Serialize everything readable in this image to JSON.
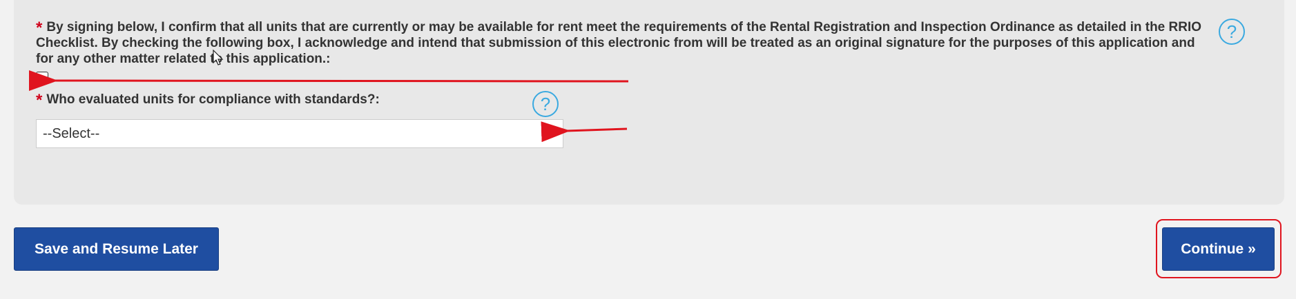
{
  "form": {
    "signature_statement": "By signing below, I confirm that all units that are currently or may be available for rent meet the requirements of the Rental Registration and Inspection Ordinance as detailed in the RRIO Checklist. By checking the following box, I acknowledge and intend that submission of this electronic from will be treated as an original signature for the purposes of this application and for any other matter related to this application.:",
    "signature_required_marker": "*",
    "signature_checkbox_checked": false,
    "evaluator_label": "Who evaluated units for compliance with standards?:",
    "evaluator_required_marker": "*",
    "evaluator_select_value": "--Select--",
    "help_icon_glyph": "?"
  },
  "actions": {
    "save_label": "Save and Resume Later",
    "continue_label": "Continue »"
  },
  "colors": {
    "button_bg": "#1f4ea1",
    "required_star": "#d0021b",
    "help_icon": "#3aa9e0",
    "annotation_red": "#e0141e",
    "panel_bg": "#e8e8e8"
  },
  "icons": {
    "help": "question-circle-icon",
    "caret": "caret-down-icon",
    "pointer": "mouse-pointer-icon"
  }
}
